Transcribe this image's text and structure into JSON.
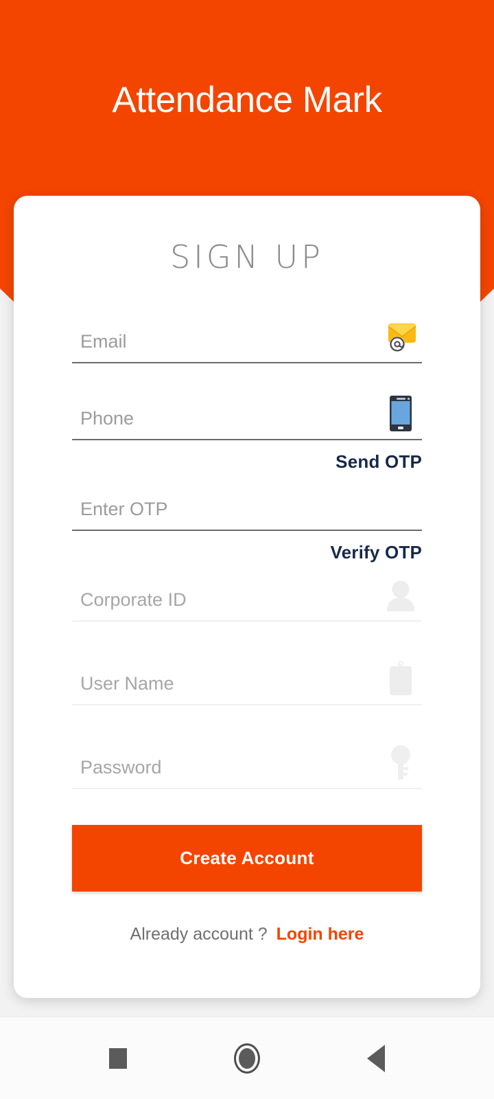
{
  "app": {
    "title": "Attendance Mark",
    "brand_color": "#f44500"
  },
  "card": {
    "heading": "SIGN UP"
  },
  "fields": [
    {
      "name": "email",
      "placeholder": "Email",
      "value": "",
      "icon": "email-envelope-at-icon",
      "state": "enabled"
    },
    {
      "name": "phone",
      "placeholder": "Phone",
      "value": "",
      "icon": "smartphone-icon",
      "state": "enabled"
    },
    {
      "name": "otp",
      "placeholder": "Enter OTP",
      "value": "",
      "icon": "",
      "state": "enabled"
    },
    {
      "name": "corporate_id",
      "placeholder": "Corporate ID",
      "value": "",
      "icon": "person-icon",
      "state": "disabled"
    },
    {
      "name": "user_name",
      "placeholder": "User Name",
      "value": "",
      "icon": "id-badge-icon",
      "state": "disabled"
    },
    {
      "name": "password",
      "placeholder": "Password",
      "value": "",
      "icon": "key-icon",
      "state": "disabled"
    }
  ],
  "actions": {
    "send_otp": "Send OTP",
    "verify_otp": "Verify OTP",
    "create_account": "Create Account",
    "otp_link_color": "#17294a"
  },
  "login": {
    "prompt": "Already account ?",
    "link": "Login here",
    "link_color": "#f44500"
  },
  "navbar": {
    "recents": "recents-square-icon",
    "home": "home-circle-icon",
    "back": "back-triangle-icon"
  }
}
